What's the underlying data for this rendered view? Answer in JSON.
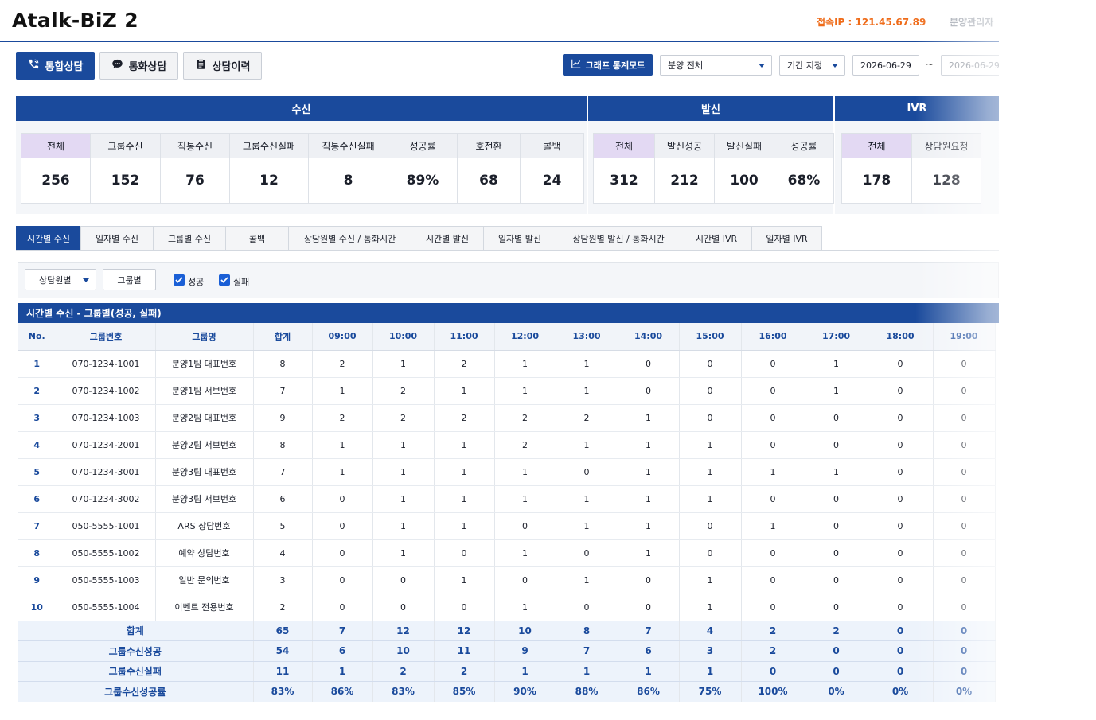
{
  "app": {
    "title": "Atalk-BiZ 2",
    "ip_label": "접속IP : 121.45.67.89",
    "admin": "분양관리자"
  },
  "main_tabs": [
    {
      "label": "통합상담",
      "icon": "phone-icon",
      "active": true
    },
    {
      "label": "통화상담",
      "icon": "chat-icon",
      "active": false
    },
    {
      "label": "상담이력",
      "icon": "clipboard-icon",
      "active": false
    }
  ],
  "controls": {
    "graph_mode": "그래프 통계모드",
    "scope_select": "분양 전체",
    "period_select": "기간 지정",
    "date_from": "2026-06-29",
    "tilde": "~",
    "date_to": "2026-06-29"
  },
  "summary": {
    "inbound": {
      "title": "수신",
      "cells": [
        {
          "label": "전체",
          "value": "256"
        },
        {
          "label": "그룹수신",
          "value": "152"
        },
        {
          "label": "직통수신",
          "value": "76"
        },
        {
          "label": "그룹수신실패",
          "value": "12"
        },
        {
          "label": "직통수신실패",
          "value": "8"
        },
        {
          "label": "성공률",
          "value": "89%"
        },
        {
          "label": "호전환",
          "value": "68"
        },
        {
          "label": "콜백",
          "value": "24"
        }
      ]
    },
    "outbound": {
      "title": "발신",
      "cells": [
        {
          "label": "전체",
          "value": "312"
        },
        {
          "label": "발신성공",
          "value": "212"
        },
        {
          "label": "발신실패",
          "value": "100"
        },
        {
          "label": "성공률",
          "value": "68%"
        }
      ]
    },
    "ivr": {
      "title": "IVR",
      "cells": [
        {
          "label": "전체",
          "value": "178"
        },
        {
          "label": "상담원요청",
          "value": "128"
        }
      ]
    }
  },
  "sub_tabs": [
    {
      "label": "시간별 수신",
      "active": true
    },
    {
      "label": "일자별 수신"
    },
    {
      "label": "그룹별 수신"
    },
    {
      "label": "콜백"
    },
    {
      "label": "상담원별 수신 / 통화시간"
    },
    {
      "label": "시간별 발신"
    },
    {
      "label": "일자별 발신"
    },
    {
      "label": "상담원별 발신 / 통화시간"
    },
    {
      "label": "시간별 IVR"
    },
    {
      "label": "일자별 IVR"
    }
  ],
  "filters": {
    "mode_select": "상담원별",
    "group_button": "그룹별",
    "success_label": "성공",
    "fail_label": "실패"
  },
  "table": {
    "title": "시간별 수신 - 그룹별(성공, 실패)",
    "headers": [
      "No.",
      "그룹번호",
      "그룹명",
      "합계",
      "09:00",
      "10:00",
      "11:00",
      "12:00",
      "13:00",
      "14:00",
      "15:00",
      "16:00",
      "17:00",
      "18:00",
      "19:00"
    ],
    "rows": [
      [
        "1",
        "070-1234-1001",
        "분양1팀 대표번호",
        "8",
        "2",
        "1",
        "2",
        "1",
        "1",
        "0",
        "0",
        "0",
        "1",
        "0",
        "0"
      ],
      [
        "2",
        "070-1234-1002",
        "분양1팀 서브번호",
        "7",
        "1",
        "2",
        "1",
        "1",
        "1",
        "0",
        "0",
        "0",
        "1",
        "0",
        "0"
      ],
      [
        "3",
        "070-1234-1003",
        "분양2팀 대표번호",
        "9",
        "2",
        "2",
        "2",
        "2",
        "2",
        "1",
        "0",
        "0",
        "0",
        "0",
        "0"
      ],
      [
        "4",
        "070-1234-2001",
        "분양2팀 서브번호",
        "8",
        "1",
        "1",
        "1",
        "2",
        "1",
        "1",
        "1",
        "0",
        "0",
        "0",
        "0"
      ],
      [
        "5",
        "070-1234-3001",
        "분양3팀 대표번호",
        "7",
        "1",
        "1",
        "1",
        "1",
        "0",
        "1",
        "1",
        "1",
        "1",
        "0",
        "0"
      ],
      [
        "6",
        "070-1234-3002",
        "분양3팀 서브번호",
        "6",
        "0",
        "1",
        "1",
        "1",
        "1",
        "1",
        "1",
        "0",
        "0",
        "0",
        "0"
      ],
      [
        "7",
        "050-5555-1001",
        "ARS 상담번호",
        "5",
        "0",
        "1",
        "1",
        "0",
        "1",
        "1",
        "0",
        "1",
        "0",
        "0",
        "0"
      ],
      [
        "8",
        "050-5555-1002",
        "예약 상담번호",
        "4",
        "0",
        "1",
        "0",
        "1",
        "0",
        "1",
        "0",
        "0",
        "0",
        "0",
        "0"
      ],
      [
        "9",
        "050-5555-1003",
        "일반 문의번호",
        "3",
        "0",
        "0",
        "1",
        "0",
        "1",
        "0",
        "1",
        "0",
        "0",
        "0",
        "0"
      ],
      [
        "10",
        "050-5555-1004",
        "이벤트 전용번호",
        "2",
        "0",
        "0",
        "0",
        "1",
        "0",
        "0",
        "1",
        "0",
        "0",
        "0",
        "0"
      ]
    ],
    "footer": [
      [
        "합계",
        "65",
        "7",
        "12",
        "12",
        "10",
        "8",
        "7",
        "4",
        "2",
        "2",
        "0",
        "0"
      ],
      [
        "그룹수신성공",
        "54",
        "6",
        "10",
        "11",
        "9",
        "7",
        "6",
        "3",
        "2",
        "0",
        "0",
        "0"
      ],
      [
        "그룹수신실패",
        "11",
        "1",
        "2",
        "2",
        "1",
        "1",
        "1",
        "1",
        "0",
        "0",
        "0",
        "0"
      ],
      [
        "그룹수신성공률",
        "83%",
        "86%",
        "83%",
        "85%",
        "90%",
        "88%",
        "86%",
        "75%",
        "100%",
        "0%",
        "0%",
        "0%"
      ]
    ]
  }
}
